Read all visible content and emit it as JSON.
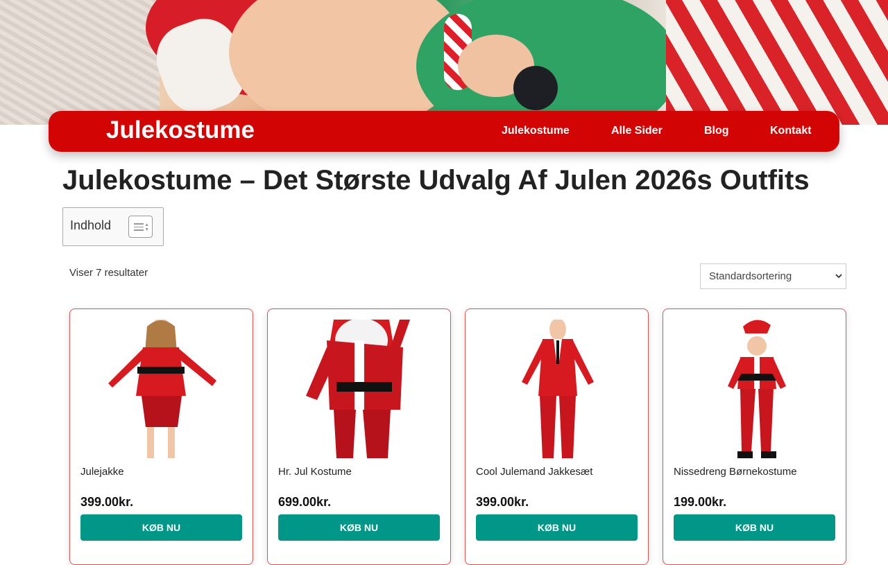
{
  "header": {
    "brand": "Julekostume",
    "nav": [
      "Julekostume",
      "Alle Sider",
      "Blog",
      "Kontakt"
    ]
  },
  "main": {
    "title": "Julekostume – Det Største Udvalg Af Julen 2026s Outfits",
    "toc_label": "Indhold",
    "result_count": "Viser 7 resultater",
    "sort_selected": "Standardsortering"
  },
  "products": [
    {
      "name": "Julejakke",
      "price": "399.00kr.",
      "button": "KØB NU"
    },
    {
      "name": "Hr. Jul Kostume",
      "price": "699.00kr.",
      "button": "KØB NU"
    },
    {
      "name": "Cool Julemand Jakkesæt",
      "price": "399.00kr.",
      "button": "KØB NU"
    },
    {
      "name": "Nissedreng Børnekostume",
      "price": "199.00kr.",
      "button": "KØB NU"
    }
  ],
  "colors": {
    "nav_bg": "#d20404",
    "button_bg": "#009688",
    "card_border": "#d9534f"
  },
  "icons": [
    "list-toggle-icon",
    "sort-caret-icon"
  ]
}
